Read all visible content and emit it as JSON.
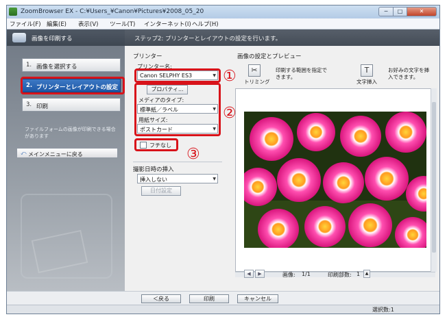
{
  "window": {
    "title": "ZoomBrowser EX - C:¥Users_¥Canon¥Pictures¥2008_05_20",
    "controls": {
      "minimize": "─",
      "maximize": "□",
      "close": "✕"
    }
  },
  "menu": [
    "ファイル(F)",
    "編集(E)",
    "表示(V)",
    "ツール(T)",
    "インターネット(I)",
    "ヘルプ(H)"
  ],
  "left_panel": {
    "header": "画像を印刷する",
    "steps": [
      {
        "num": "1.",
        "label": "画像を選択する"
      },
      {
        "num": "2.",
        "label": "プリンターとレイアウトの設定"
      },
      {
        "num": "3.",
        "label": "印刷"
      }
    ],
    "note": "ファイルフォームの画像が印刷できる場合があります",
    "main_menu_button": "メインメニューに戻る",
    "main_menu_arrow": "⤺"
  },
  "step_header": "ステップ2: プリンターとレイアウトの設定を行います。",
  "printer": {
    "section_label": "プリンター",
    "printer_name_label": "プリンター名:",
    "printer_name_value": "Canon SELPHY ES3",
    "properties_button": "プロパティ...",
    "media_type_label": "メディアのタイプ:",
    "media_type_value": "標準紙／ラベル",
    "paper_size_label": "用紙サイズ:",
    "paper_size_value": "ポストカード",
    "borderless_label": "フチなし",
    "date_section_label": "撮影日時の挿入",
    "date_value": "挿入しない",
    "date_settings_button": "日付設定"
  },
  "annotations": {
    "one": "①",
    "two": "②",
    "three": "③"
  },
  "preview": {
    "section_label": "画像の設定とプレビュー",
    "trim_label": "トリミング",
    "trim_desc": "印刷する範囲を指定できます。",
    "text_label": "文字挿入",
    "text_desc": "お好みの文字を挿入できます。",
    "text_icon": "T",
    "image_label": "画像:",
    "image_value": "1/1",
    "copies_label": "印刷部数:",
    "copies_value": "1",
    "prev": "◀",
    "next": "▶"
  },
  "buttons": {
    "back": "＜戻る",
    "print": "印刷",
    "cancel": "キャンセル"
  },
  "status": {
    "label": "選択数:",
    "value": "1"
  },
  "colors": {
    "annotation_red": "#d8131a",
    "active_step": "#1d57a5",
    "step_marker": "#f2b51a"
  }
}
